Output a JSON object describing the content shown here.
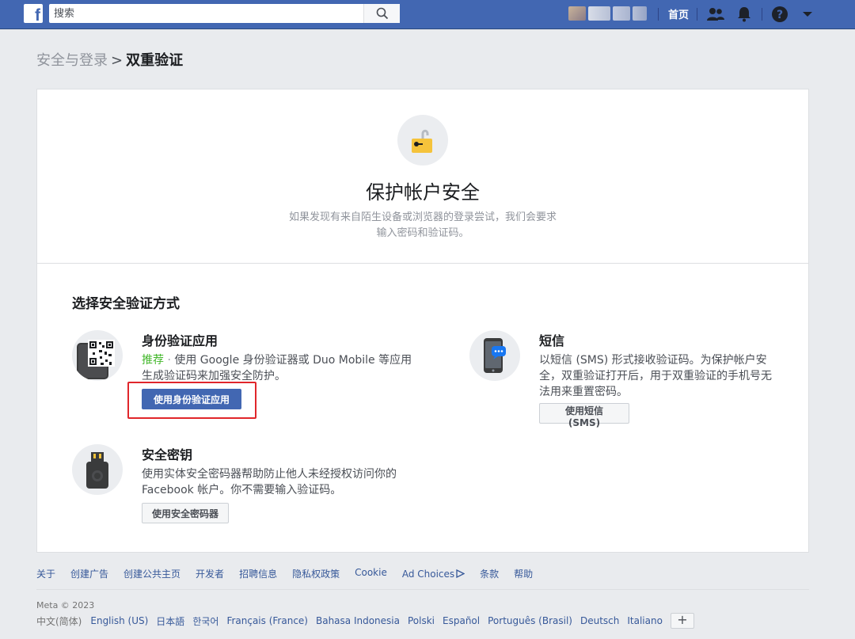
{
  "topbar": {
    "logo": "f",
    "search_placeholder": "搜索",
    "home_label": "首页",
    "icons": [
      "friends-icon",
      "notifications-icon",
      "help-icon",
      "dropdown-icon"
    ]
  },
  "breadcrumb": {
    "parent": "安全与登录",
    "separator": ">",
    "current": "双重验证"
  },
  "hero": {
    "title": "保护帐户安全",
    "description": "如果发现有来自陌生设备或浏览器的登录尝试，我们会要求输入密码和验证码。"
  },
  "methods_section": {
    "title": "选择安全验证方式",
    "auth_app": {
      "title": "身份验证应用",
      "recommend": "推荐",
      "dot": " · ",
      "description": "使用 Google 身份验证器或 Duo Mobile 等应用生成验证码来加强安全防护。",
      "button": "使用身份验证应用"
    },
    "sms": {
      "title": "短信",
      "description": "以短信 (SMS) 形式接收验证码。为保护帐户安全，双重验证打开后，用于双重验证的手机号无法用来重置密码。",
      "button": "使用短信 (SMS)"
    },
    "security_key": {
      "title": "安全密钥",
      "description": "使用实体安全密码器帮助防止他人未经授权访问你的 Facebook 帐户。你不需要输入验证码。",
      "button": "使用安全密码器"
    }
  },
  "footer": {
    "links": [
      "关于",
      "创建广告",
      "创建公共主页",
      "开发者",
      "招聘信息",
      "隐私权政策",
      "Cookie",
      "Ad Choices",
      "条款",
      "帮助"
    ],
    "copyright": "Meta © 2023",
    "current_language": "中文(简体)",
    "languages": [
      "English (US)",
      "日本語",
      "한국어",
      "Français (France)",
      "Bahasa Indonesia",
      "Polski",
      "Español",
      "Português (Brasil)",
      "Deutsch",
      "Italiano"
    ],
    "more_languages": "+"
  },
  "colors": {
    "brand": "#4267b2",
    "highlight_box": "#e0262b",
    "recommend": "#42b72a",
    "lock": "#f5c33b"
  }
}
